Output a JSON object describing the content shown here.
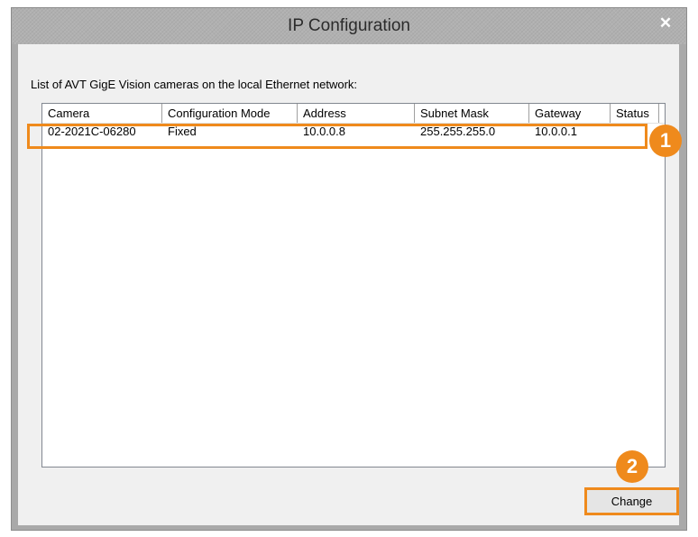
{
  "window": {
    "title": "IP Configuration",
    "close_glyph": "✕"
  },
  "description": "List of AVT GigE Vision cameras on the local Ethernet network:",
  "columns": [
    "Camera",
    "Configuration Mode",
    "Address",
    "Subnet Mask",
    "Gateway",
    "Status"
  ],
  "rows": [
    {
      "camera": "02-2021C-06280",
      "configuration_mode": "Fixed",
      "address": "10.0.0.8",
      "subnet_mask": "255.255.255.0",
      "gateway": "10.0.0.1",
      "status": ""
    }
  ],
  "annotations": {
    "badge_1": "1",
    "badge_2": "2",
    "accent_color": "#ef8a1c"
  },
  "buttons": {
    "change_label": "Change"
  }
}
